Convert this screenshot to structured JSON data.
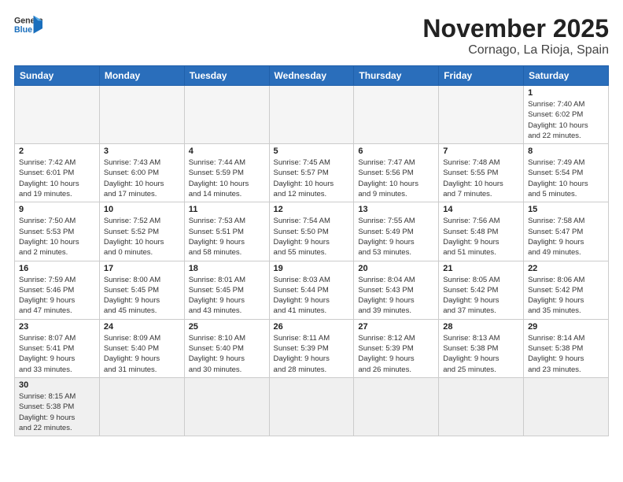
{
  "logo": {
    "text_general": "General",
    "text_blue": "Blue"
  },
  "title": "November 2025",
  "subtitle": "Cornago, La Rioja, Spain",
  "header_days": [
    "Sunday",
    "Monday",
    "Tuesday",
    "Wednesday",
    "Thursday",
    "Friday",
    "Saturday"
  ],
  "weeks": [
    [
      {
        "day": "",
        "info": ""
      },
      {
        "day": "",
        "info": ""
      },
      {
        "day": "",
        "info": ""
      },
      {
        "day": "",
        "info": ""
      },
      {
        "day": "",
        "info": ""
      },
      {
        "day": "",
        "info": ""
      },
      {
        "day": "1",
        "info": "Sunrise: 7:40 AM\nSunset: 6:02 PM\nDaylight: 10 hours\nand 22 minutes."
      }
    ],
    [
      {
        "day": "2",
        "info": "Sunrise: 7:42 AM\nSunset: 6:01 PM\nDaylight: 10 hours\nand 19 minutes."
      },
      {
        "day": "3",
        "info": "Sunrise: 7:43 AM\nSunset: 6:00 PM\nDaylight: 10 hours\nand 17 minutes."
      },
      {
        "day": "4",
        "info": "Sunrise: 7:44 AM\nSunset: 5:59 PM\nDaylight: 10 hours\nand 14 minutes."
      },
      {
        "day": "5",
        "info": "Sunrise: 7:45 AM\nSunset: 5:57 PM\nDaylight: 10 hours\nand 12 minutes."
      },
      {
        "day": "6",
        "info": "Sunrise: 7:47 AM\nSunset: 5:56 PM\nDaylight: 10 hours\nand 9 minutes."
      },
      {
        "day": "7",
        "info": "Sunrise: 7:48 AM\nSunset: 5:55 PM\nDaylight: 10 hours\nand 7 minutes."
      },
      {
        "day": "8",
        "info": "Sunrise: 7:49 AM\nSunset: 5:54 PM\nDaylight: 10 hours\nand 5 minutes."
      }
    ],
    [
      {
        "day": "9",
        "info": "Sunrise: 7:50 AM\nSunset: 5:53 PM\nDaylight: 10 hours\nand 2 minutes."
      },
      {
        "day": "10",
        "info": "Sunrise: 7:52 AM\nSunset: 5:52 PM\nDaylight: 10 hours\nand 0 minutes."
      },
      {
        "day": "11",
        "info": "Sunrise: 7:53 AM\nSunset: 5:51 PM\nDaylight: 9 hours\nand 58 minutes."
      },
      {
        "day": "12",
        "info": "Sunrise: 7:54 AM\nSunset: 5:50 PM\nDaylight: 9 hours\nand 55 minutes."
      },
      {
        "day": "13",
        "info": "Sunrise: 7:55 AM\nSunset: 5:49 PM\nDaylight: 9 hours\nand 53 minutes."
      },
      {
        "day": "14",
        "info": "Sunrise: 7:56 AM\nSunset: 5:48 PM\nDaylight: 9 hours\nand 51 minutes."
      },
      {
        "day": "15",
        "info": "Sunrise: 7:58 AM\nSunset: 5:47 PM\nDaylight: 9 hours\nand 49 minutes."
      }
    ],
    [
      {
        "day": "16",
        "info": "Sunrise: 7:59 AM\nSunset: 5:46 PM\nDaylight: 9 hours\nand 47 minutes."
      },
      {
        "day": "17",
        "info": "Sunrise: 8:00 AM\nSunset: 5:45 PM\nDaylight: 9 hours\nand 45 minutes."
      },
      {
        "day": "18",
        "info": "Sunrise: 8:01 AM\nSunset: 5:45 PM\nDaylight: 9 hours\nand 43 minutes."
      },
      {
        "day": "19",
        "info": "Sunrise: 8:03 AM\nSunset: 5:44 PM\nDaylight: 9 hours\nand 41 minutes."
      },
      {
        "day": "20",
        "info": "Sunrise: 8:04 AM\nSunset: 5:43 PM\nDaylight: 9 hours\nand 39 minutes."
      },
      {
        "day": "21",
        "info": "Sunrise: 8:05 AM\nSunset: 5:42 PM\nDaylight: 9 hours\nand 37 minutes."
      },
      {
        "day": "22",
        "info": "Sunrise: 8:06 AM\nSunset: 5:42 PM\nDaylight: 9 hours\nand 35 minutes."
      }
    ],
    [
      {
        "day": "23",
        "info": "Sunrise: 8:07 AM\nSunset: 5:41 PM\nDaylight: 9 hours\nand 33 minutes."
      },
      {
        "day": "24",
        "info": "Sunrise: 8:09 AM\nSunset: 5:40 PM\nDaylight: 9 hours\nand 31 minutes."
      },
      {
        "day": "25",
        "info": "Sunrise: 8:10 AM\nSunset: 5:40 PM\nDaylight: 9 hours\nand 30 minutes."
      },
      {
        "day": "26",
        "info": "Sunrise: 8:11 AM\nSunset: 5:39 PM\nDaylight: 9 hours\nand 28 minutes."
      },
      {
        "day": "27",
        "info": "Sunrise: 8:12 AM\nSunset: 5:39 PM\nDaylight: 9 hours\nand 26 minutes."
      },
      {
        "day": "28",
        "info": "Sunrise: 8:13 AM\nSunset: 5:38 PM\nDaylight: 9 hours\nand 25 minutes."
      },
      {
        "day": "29",
        "info": "Sunrise: 8:14 AM\nSunset: 5:38 PM\nDaylight: 9 hours\nand 23 minutes."
      }
    ],
    [
      {
        "day": "30",
        "info": "Sunrise: 8:15 AM\nSunset: 5:38 PM\nDaylight: 9 hours\nand 22 minutes."
      },
      {
        "day": "",
        "info": ""
      },
      {
        "day": "",
        "info": ""
      },
      {
        "day": "",
        "info": ""
      },
      {
        "day": "",
        "info": ""
      },
      {
        "day": "",
        "info": ""
      },
      {
        "day": "",
        "info": ""
      }
    ]
  ]
}
